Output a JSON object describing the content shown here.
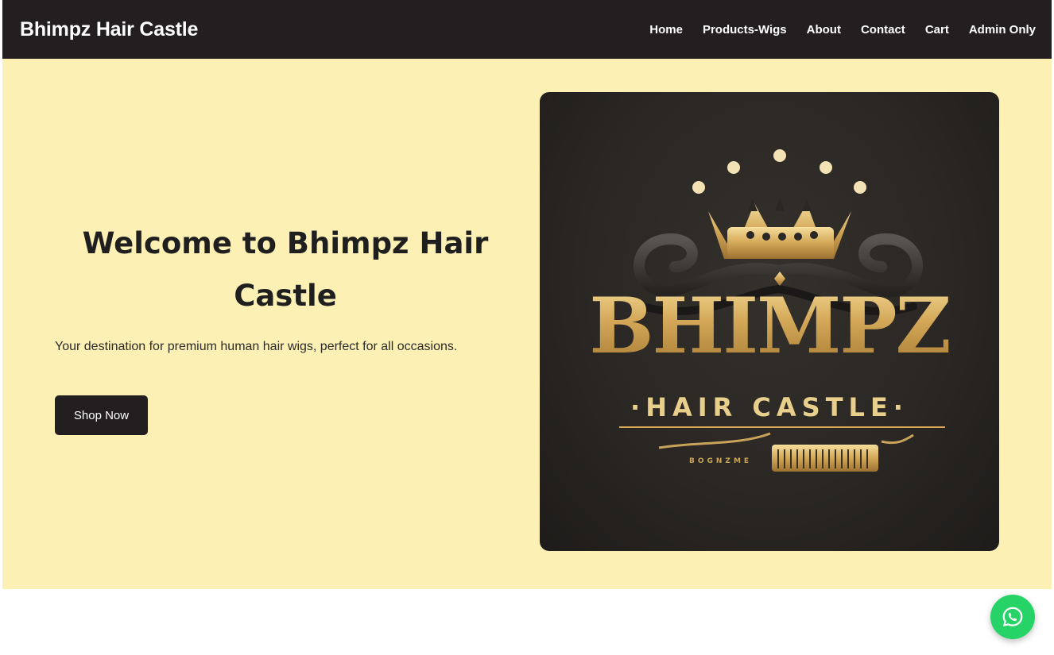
{
  "navbar": {
    "brand": "Bhimpz Hair Castle",
    "links": [
      "Home",
      "Products-Wigs",
      "About",
      "Contact",
      "Cart",
      "Admin Only"
    ]
  },
  "hero": {
    "title": "Welcome to Bhimpz Hair Castle",
    "subtitle": "Your destination for premium human hair wigs, perfect for all occasions.",
    "cta_label": "Shop Now"
  },
  "logo_image": {
    "wordmark": "BHIMPZ",
    "tagline": "·HAIR CASTLE·",
    "small_text": "BOGNZME"
  },
  "floating": {
    "icon": "whatsapp-icon"
  },
  "colors": {
    "navbar_bg": "#231f20",
    "hero_bg": "#fdf0b4",
    "button_bg": "#231f20",
    "whatsapp_green": "#25d366",
    "gold": "#d3a757"
  }
}
